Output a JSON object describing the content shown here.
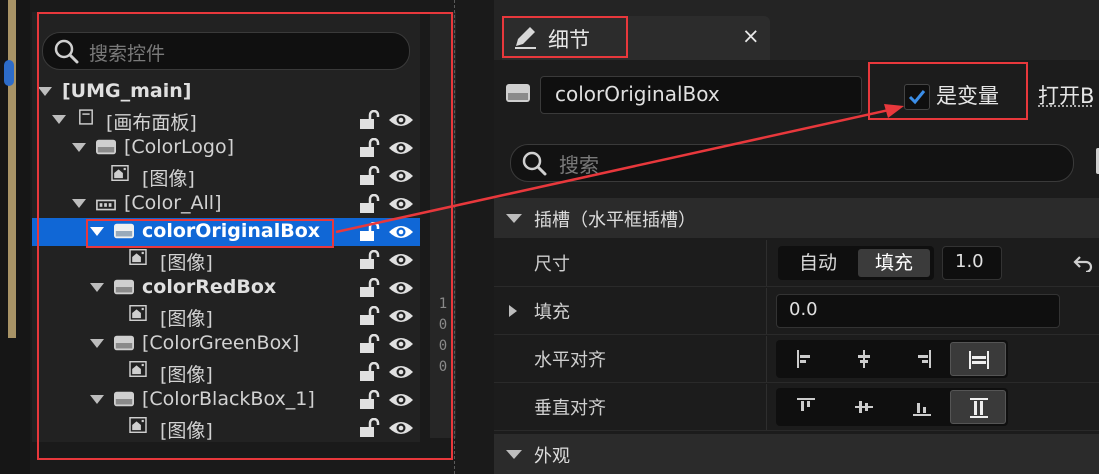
{
  "hierarchy": {
    "search_placeholder": "搜索控件",
    "rows": [
      {
        "label": "[UMG_main]",
        "bold": true
      },
      {
        "label": "[画布面板]"
      },
      {
        "label": "[ColorLogo]"
      },
      {
        "label": "[图像]"
      },
      {
        "label": "[Color_All]"
      },
      {
        "label": "colorOriginalBox",
        "bold": true,
        "selected": true
      },
      {
        "label": "[图像]"
      },
      {
        "label": "colorRedBox",
        "bold": true
      },
      {
        "label": "[图像]"
      },
      {
        "label": "[ColorGreenBox]"
      },
      {
        "label": "[图像]"
      },
      {
        "label": "[ColorBlackBox_1]"
      },
      {
        "label": "[图像]"
      }
    ],
    "ruler_text": "1000"
  },
  "details": {
    "tab_title": "细节",
    "tab_close": "×",
    "name_value": "colorOriginalBox",
    "is_variable_label": "是变量",
    "is_variable_checked": true,
    "open_label": "打开B",
    "search_placeholder": "搜索",
    "slot_section": "插槽（水平框插槽）",
    "size_label": "尺寸",
    "size_auto": "自动",
    "size_fill": "填充",
    "size_value": "1.0",
    "padding_label": "填充",
    "padding_value": "0.0",
    "h_align_label": "水平对齐",
    "v_align_label": "垂直对齐",
    "appearance_section": "外观"
  },
  "colors": {
    "selection": "#1067d6",
    "annotation_red": "#e8383c",
    "checkbox_blue": "#3b8ee8"
  }
}
